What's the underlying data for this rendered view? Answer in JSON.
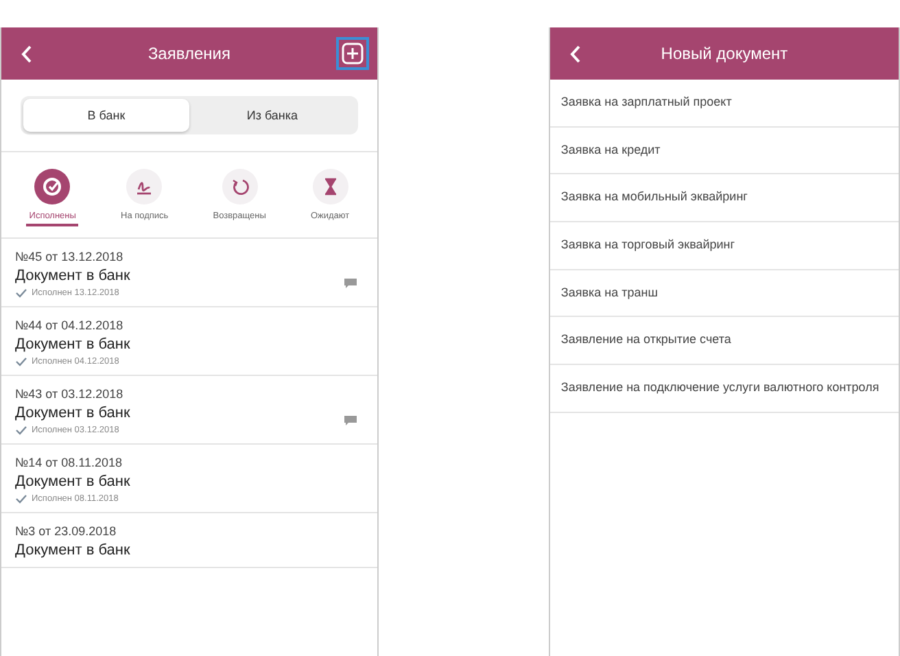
{
  "left_screen": {
    "title": "Заявления",
    "segments": [
      {
        "label": "В банк",
        "selected": true
      },
      {
        "label": "Из банка",
        "selected": false
      }
    ],
    "filters": [
      {
        "kind": "done",
        "label": "Исполнены",
        "selected": true
      },
      {
        "kind": "sign",
        "label": "На подпись",
        "selected": false
      },
      {
        "kind": "returned",
        "label": "Возвращены",
        "selected": false
      },
      {
        "kind": "waiting",
        "label": "Ожидают",
        "selected": false
      }
    ],
    "documents": [
      {
        "number": "№45 от 13.12.2018",
        "title": "Документ в банк",
        "status": "Исполнен 13.12.2018",
        "has_comment": true
      },
      {
        "number": "№44 от 04.12.2018",
        "title": "Документ в банк",
        "status": "Исполнен 04.12.2018",
        "has_comment": false
      },
      {
        "number": "№43 от 03.12.2018",
        "title": "Документ в банк",
        "status": "Исполнен 03.12.2018",
        "has_comment": true
      },
      {
        "number": "№14 от 08.11.2018",
        "title": "Документ в банк",
        "status": "Исполнен 08.11.2018",
        "has_comment": false
      },
      {
        "number": "№3 от 23.09.2018",
        "title": "Документ в банк"
      }
    ]
  },
  "right_screen": {
    "title": "Новый документ",
    "items": [
      "Заявка на зарплатный проект",
      "Заявка на кредит",
      "Заявка на мобильный эквайринг",
      "Заявка на торговый эквайринг",
      "Заявка на транш",
      "Заявление на открытие счета",
      "Заявление на подключение услуги валютного контроля"
    ]
  }
}
